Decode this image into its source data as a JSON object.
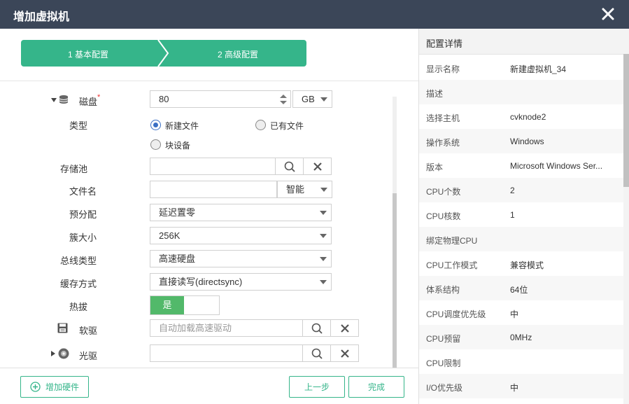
{
  "window": {
    "title": "增加虚拟机"
  },
  "steps": [
    {
      "label": "1 基本配置"
    },
    {
      "label": "2 高级配置"
    }
  ],
  "colors": {
    "accent": "#35b58a",
    "titlebar": "#3b4658",
    "toggle_on": "#52b96a",
    "radio": "#3a6fc4"
  },
  "disk": {
    "label": "磁盘",
    "required_mark": "*",
    "size_value": "80",
    "unit": "GB",
    "type_label": "类型",
    "type_options": [
      "新建文件",
      "已有文件",
      "块设备"
    ],
    "selected_type": "新建文件",
    "pool_label": "存储池",
    "pool_value": "",
    "filename_label": "文件名",
    "filename_value": "",
    "filename_mode": "智能",
    "prealloc_label": "预分配",
    "prealloc_value": "延迟置零",
    "cluster_label": "簇大小",
    "cluster_value": "256K",
    "bus_label": "总线类型",
    "bus_value": "高速硬盘",
    "cache_label": "缓存方式",
    "cache_value": "直接读写(directsync)",
    "hotplug_label": "热拔",
    "hotplug_value": "是"
  },
  "floppy": {
    "label": "软驱",
    "placeholder": "自动加载高速驱动"
  },
  "cdrom": {
    "label": "光驱",
    "value": ""
  },
  "footer": {
    "add_hardware": "增加硬件",
    "prev": "上一步",
    "finish": "完成"
  },
  "details": {
    "header": "配置详情",
    "rows": [
      {
        "k": "显示名称",
        "v": "新建虚拟机_34"
      },
      {
        "k": "描述",
        "v": ""
      },
      {
        "k": "选择主机",
        "v": "cvknode2"
      },
      {
        "k": "操作系统",
        "v": "Windows"
      },
      {
        "k": "版本",
        "v": "Microsoft Windows Ser..."
      },
      {
        "k": "CPU个数",
        "v": "2"
      },
      {
        "k": "CPU核数",
        "v": "1"
      },
      {
        "k": "绑定物理CPU",
        "v": ""
      },
      {
        "k": "CPU工作模式",
        "v": "兼容模式"
      },
      {
        "k": "体系结构",
        "v": "64位"
      },
      {
        "k": "CPU调度优先级",
        "v": "中"
      },
      {
        "k": "CPU预留",
        "v": "0MHz"
      },
      {
        "k": "CPU限制",
        "v": ""
      },
      {
        "k": "I/O优先级",
        "v": "中"
      }
    ]
  }
}
